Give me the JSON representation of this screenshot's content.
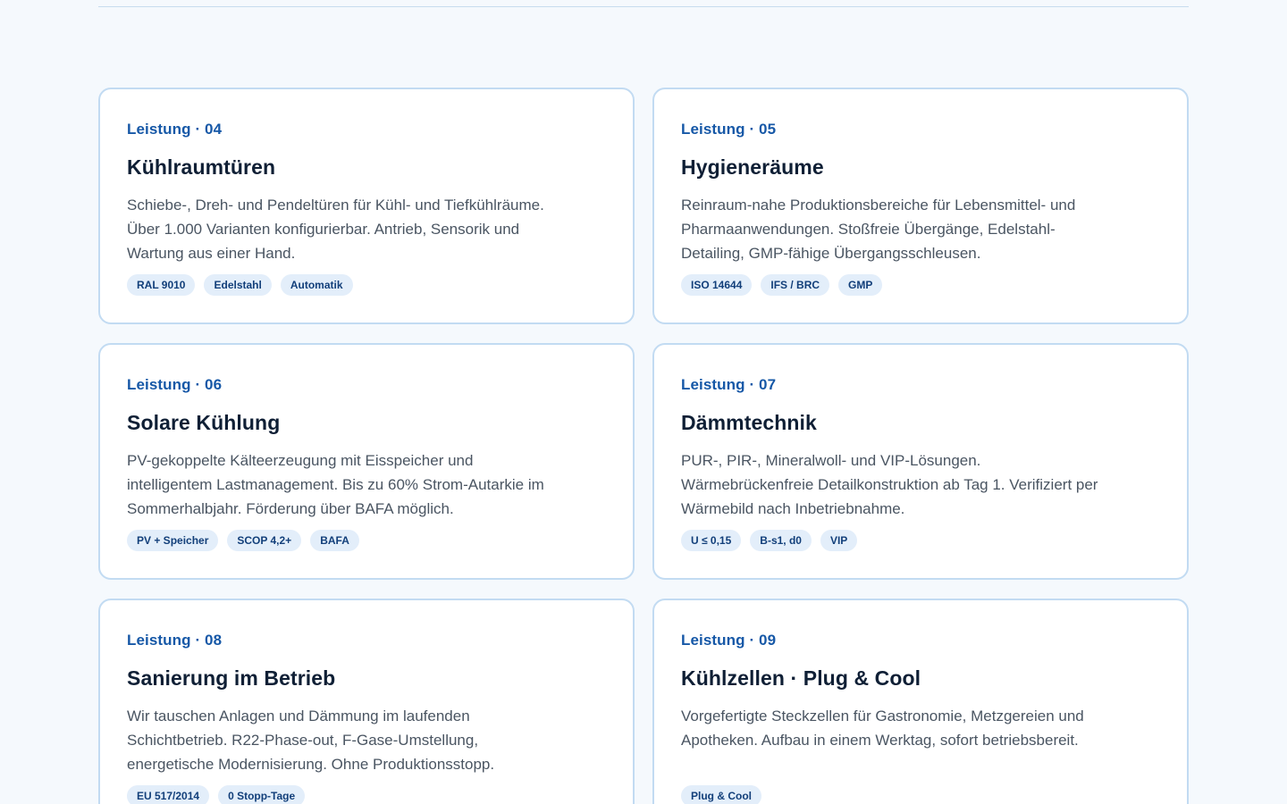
{
  "cards": [
    {
      "kicker": "Leistung · 04",
      "title": "Kühlraumtüren",
      "description": "Schiebe-, Dreh- und Pendeltüren für Kühl- und Tiefkühlräume. Über 1.000 Varianten konfigurierbar. Antrieb, Sensorik und Wartung aus einer Hand.",
      "tags": [
        "RAL 9010",
        "Edelstahl",
        "Automatik"
      ]
    },
    {
      "kicker": "Leistung · 05",
      "title": "Hygieneräume",
      "description": "Reinraum-nahe Produktionsbereiche für Lebensmittel- und Pharmaanwendungen. Stoßfreie Übergänge, Edelstahl-Detailing, GMP-fähige Übergangsschleusen.",
      "tags": [
        "ISO 14644",
        "IFS / BRC",
        "GMP"
      ]
    },
    {
      "kicker": "Leistung · 06",
      "title": "Solare Kühlung",
      "description": "PV-gekoppelte Kälteerzeugung mit Eisspeicher und intelligentem Lastmanagement. Bis zu 60% Strom-Autarkie im Sommerhalbjahr. Förderung über BAFA möglich.",
      "tags": [
        "PV + Speicher",
        "SCOP 4,2+",
        "BAFA"
      ]
    },
    {
      "kicker": "Leistung · 07",
      "title": "Dämmtechnik",
      "description": "PUR-, PIR-, Mineralwoll- und VIP-Lösungen. Wärmebrückenfreie Detailkonstruktion ab Tag 1. Verifiziert per Wärmebild nach Inbetriebnahme.",
      "tags": [
        "U ≤ 0,15",
        "B-s1, d0",
        "VIP"
      ]
    },
    {
      "kicker": "Leistung · 08",
      "title": "Sanierung im Betrieb",
      "description": "Wir tauschen Anlagen und Dämmung im laufenden Schichtbetrieb. R22-Phase-out, F-Gase-Umstellung, energetische Modernisierung. Ohne Produktionsstopp.",
      "tags": [
        "EU 517/2014",
        "0 Stopp-Tage"
      ]
    },
    {
      "kicker": "Leistung · 09",
      "title": "Kühlzellen · Plug & Cool",
      "description": "Vorgefertigte Steckzellen für Gastronomie, Metzgereien und Apotheken. Aufbau in einem Werktag, sofort betriebsbereit.",
      "tags": [
        "Plug & Cool"
      ]
    }
  ],
  "colors": {
    "background": "#f5f9fd",
    "card_border": "#c2dbf2",
    "kicker": "#1658a7",
    "title": "#0f1f35",
    "tag_bg": "#e3eefa",
    "tag_text": "#123f7a"
  }
}
